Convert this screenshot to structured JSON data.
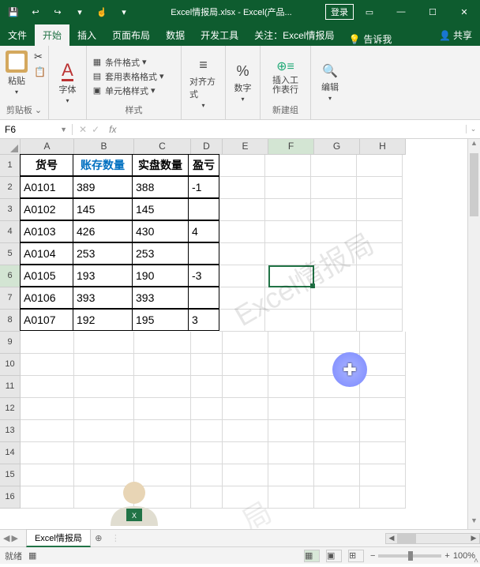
{
  "titlebar": {
    "filename": "Excel情报局.xlsx",
    "appname": "Excel(产品...",
    "login": "登录"
  },
  "tabs": {
    "file": "文件",
    "home": "开始",
    "insert": "插入",
    "layout": "页面布局",
    "data": "数据",
    "dev": "开发工具",
    "attn": "关注：Excel情报局",
    "tellme": "告诉我",
    "share": "共享"
  },
  "ribbon": {
    "paste": "粘贴",
    "clipboard": "剪贴板",
    "font_letter": "A",
    "font": "字体",
    "cond_fmt": "条件格式",
    "table_fmt": "套用表格格式",
    "cell_style": "单元格样式",
    "styles": "样式",
    "align": "对齐方式",
    "number_sym": "%",
    "number": "数字",
    "insert_row": "插入工作表行",
    "newgroup": "新建组",
    "edit": "编辑"
  },
  "namebox": {
    "ref": "F6"
  },
  "columns": [
    "A",
    "B",
    "C",
    "D",
    "E",
    "F",
    "G",
    "H"
  ],
  "rows": [
    "1",
    "2",
    "3",
    "4",
    "5",
    "6",
    "7",
    "8",
    "9",
    "10",
    "11",
    "12",
    "13",
    "14",
    "15",
    "16"
  ],
  "headers": {
    "c1": "货号",
    "c2": "账存数量",
    "c3": "实盘数量",
    "c4": "盈亏"
  },
  "data": [
    {
      "a": "A0101",
      "b": "389",
      "c": "388",
      "d": "-1"
    },
    {
      "a": "A0102",
      "b": "145",
      "c": "145",
      "d": ""
    },
    {
      "a": "A0103",
      "b": "426",
      "c": "430",
      "d": "4"
    },
    {
      "a": "A0104",
      "b": "253",
      "c": "253",
      "d": ""
    },
    {
      "a": "A0105",
      "b": "193",
      "c": "190",
      "d": "-3"
    },
    {
      "a": "A0106",
      "b": "393",
      "c": "393",
      "d": ""
    },
    {
      "a": "A0107",
      "b": "192",
      "c": "195",
      "d": "3"
    }
  ],
  "sheettab": "Excel情报局",
  "status": {
    "ready": "就绪",
    "zoom": "100%"
  },
  "watermark": "Excel情报局",
  "watermark2": "局"
}
